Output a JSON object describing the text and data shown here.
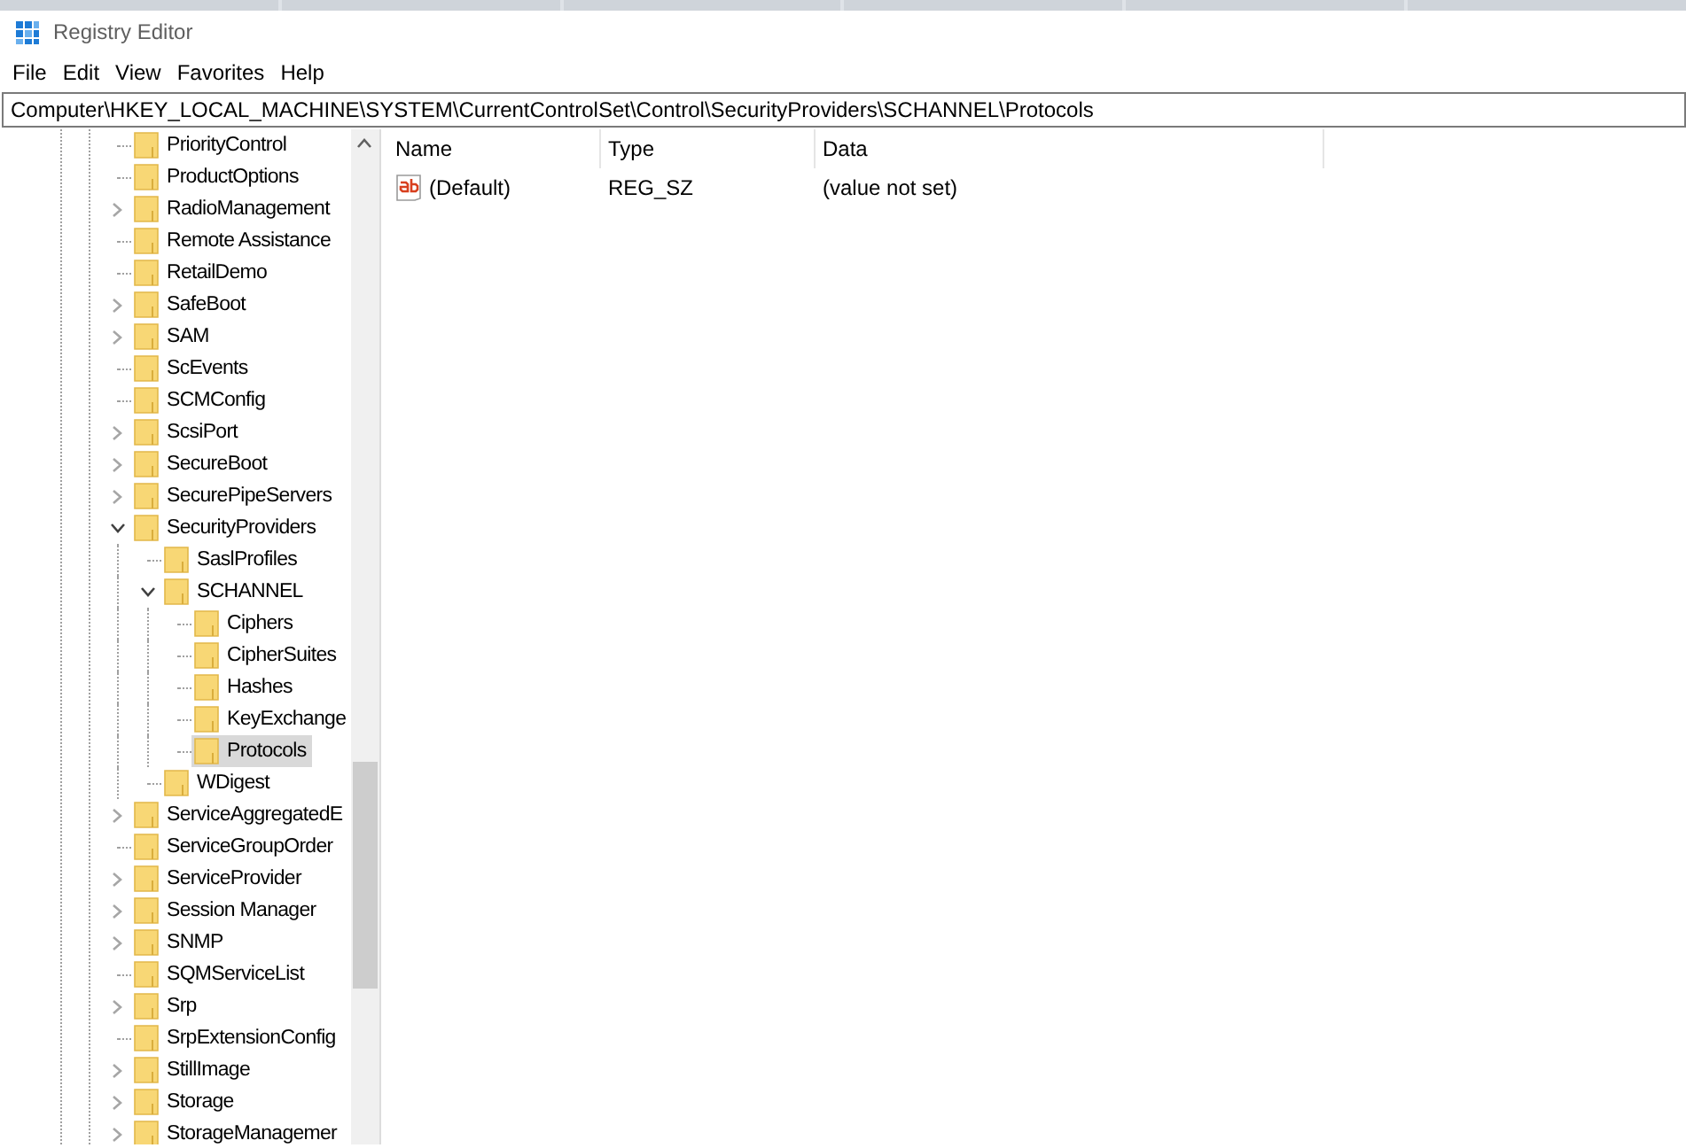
{
  "window": {
    "title": "Registry Editor"
  },
  "menu": [
    "File",
    "Edit",
    "View",
    "Favorites",
    "Help"
  ],
  "address": "Computer\\HKEY_LOCAL_MACHINE\\SYSTEM\\CurrentControlSet\\Control\\SecurityProviders\\SCHANNEL\\Protocols",
  "tree": [
    {
      "label": "PriorityControl",
      "kind": "leaf",
      "selected": false
    },
    {
      "label": "ProductOptions",
      "kind": "leaf",
      "selected": false
    },
    {
      "label": "RadioManagement",
      "kind": "collapsed",
      "selected": false
    },
    {
      "label": "Remote Assistance",
      "kind": "leaf",
      "selected": false
    },
    {
      "label": "RetailDemo",
      "kind": "leaf",
      "selected": false
    },
    {
      "label": "SafeBoot",
      "kind": "collapsed",
      "selected": false
    },
    {
      "label": "SAM",
      "kind": "collapsed",
      "selected": false
    },
    {
      "label": "ScEvents",
      "kind": "leaf",
      "selected": false
    },
    {
      "label": "SCMConfig",
      "kind": "leaf",
      "selected": false
    },
    {
      "label": "ScsiPort",
      "kind": "collapsed",
      "selected": false
    },
    {
      "label": "SecureBoot",
      "kind": "collapsed",
      "selected": false
    },
    {
      "label": "SecurePipeServers",
      "kind": "collapsed",
      "selected": false
    },
    {
      "label": "SecurityProviders",
      "kind": "expanded",
      "selected": false,
      "children": [
        {
          "label": "SaslProfiles",
          "kind": "leaf",
          "selected": false
        },
        {
          "label": "SCHANNEL",
          "kind": "expanded",
          "selected": false,
          "children": [
            {
              "label": "Ciphers",
              "kind": "leaf",
              "selected": false
            },
            {
              "label": "CipherSuites",
              "kind": "leaf",
              "selected": false
            },
            {
              "label": "Hashes",
              "kind": "leaf",
              "selected": false
            },
            {
              "label": "KeyExchange",
              "kind": "leaf",
              "selected": false
            },
            {
              "label": "Protocols",
              "kind": "leaf",
              "selected": true
            }
          ]
        },
        {
          "label": "WDigest",
          "kind": "leaf",
          "selected": false
        }
      ]
    },
    {
      "label": "ServiceAggregatedE",
      "kind": "collapsed",
      "selected": false
    },
    {
      "label": "ServiceGroupOrder",
      "kind": "leaf",
      "selected": false
    },
    {
      "label": "ServiceProvider",
      "kind": "collapsed",
      "selected": false
    },
    {
      "label": "Session Manager",
      "kind": "collapsed",
      "selected": false
    },
    {
      "label": "SNMP",
      "kind": "collapsed",
      "selected": false
    },
    {
      "label": "SQMServiceList",
      "kind": "leaf",
      "selected": false
    },
    {
      "label": "Srp",
      "kind": "collapsed",
      "selected": false
    },
    {
      "label": "SrpExtensionConfig",
      "kind": "leaf",
      "selected": false
    },
    {
      "label": "StillImage",
      "kind": "collapsed",
      "selected": false
    },
    {
      "label": "Storage",
      "kind": "collapsed",
      "selected": false
    },
    {
      "label": "StorageManagemer",
      "kind": "collapsed",
      "selected": false
    }
  ],
  "values": {
    "columns": [
      "Name",
      "Type",
      "Data"
    ],
    "rows": [
      {
        "name": "(Default)",
        "type": "REG_SZ",
        "data": "(value not set)"
      }
    ]
  }
}
